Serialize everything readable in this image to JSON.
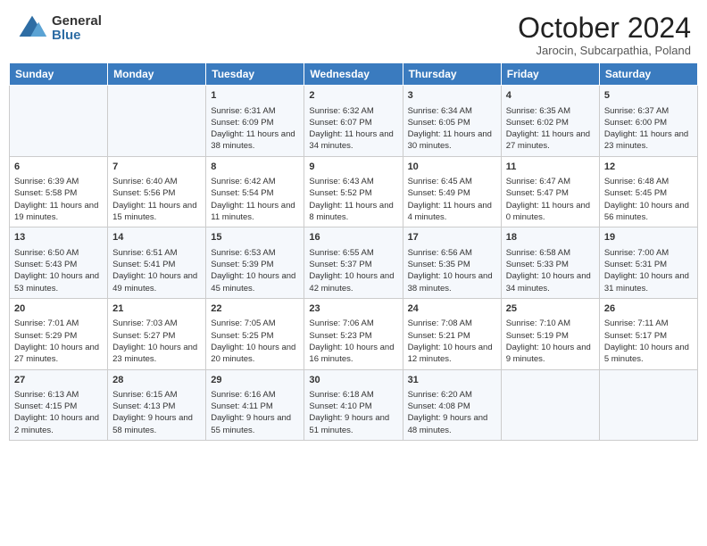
{
  "header": {
    "logo_general": "General",
    "logo_blue": "Blue",
    "month_title": "October 2024",
    "subtitle": "Jarocin, Subcarpathia, Poland"
  },
  "days_of_week": [
    "Sunday",
    "Monday",
    "Tuesday",
    "Wednesday",
    "Thursday",
    "Friday",
    "Saturday"
  ],
  "weeks": [
    [
      {
        "day": "",
        "content": ""
      },
      {
        "day": "",
        "content": ""
      },
      {
        "day": "1",
        "content": "Sunrise: 6:31 AM\nSunset: 6:09 PM\nDaylight: 11 hours and 38 minutes."
      },
      {
        "day": "2",
        "content": "Sunrise: 6:32 AM\nSunset: 6:07 PM\nDaylight: 11 hours and 34 minutes."
      },
      {
        "day": "3",
        "content": "Sunrise: 6:34 AM\nSunset: 6:05 PM\nDaylight: 11 hours and 30 minutes."
      },
      {
        "day": "4",
        "content": "Sunrise: 6:35 AM\nSunset: 6:02 PM\nDaylight: 11 hours and 27 minutes."
      },
      {
        "day": "5",
        "content": "Sunrise: 6:37 AM\nSunset: 6:00 PM\nDaylight: 11 hours and 23 minutes."
      }
    ],
    [
      {
        "day": "6",
        "content": "Sunrise: 6:39 AM\nSunset: 5:58 PM\nDaylight: 11 hours and 19 minutes."
      },
      {
        "day": "7",
        "content": "Sunrise: 6:40 AM\nSunset: 5:56 PM\nDaylight: 11 hours and 15 minutes."
      },
      {
        "day": "8",
        "content": "Sunrise: 6:42 AM\nSunset: 5:54 PM\nDaylight: 11 hours and 11 minutes."
      },
      {
        "day": "9",
        "content": "Sunrise: 6:43 AM\nSunset: 5:52 PM\nDaylight: 11 hours and 8 minutes."
      },
      {
        "day": "10",
        "content": "Sunrise: 6:45 AM\nSunset: 5:49 PM\nDaylight: 11 hours and 4 minutes."
      },
      {
        "day": "11",
        "content": "Sunrise: 6:47 AM\nSunset: 5:47 PM\nDaylight: 11 hours and 0 minutes."
      },
      {
        "day": "12",
        "content": "Sunrise: 6:48 AM\nSunset: 5:45 PM\nDaylight: 10 hours and 56 minutes."
      }
    ],
    [
      {
        "day": "13",
        "content": "Sunrise: 6:50 AM\nSunset: 5:43 PM\nDaylight: 10 hours and 53 minutes."
      },
      {
        "day": "14",
        "content": "Sunrise: 6:51 AM\nSunset: 5:41 PM\nDaylight: 10 hours and 49 minutes."
      },
      {
        "day": "15",
        "content": "Sunrise: 6:53 AM\nSunset: 5:39 PM\nDaylight: 10 hours and 45 minutes."
      },
      {
        "day": "16",
        "content": "Sunrise: 6:55 AM\nSunset: 5:37 PM\nDaylight: 10 hours and 42 minutes."
      },
      {
        "day": "17",
        "content": "Sunrise: 6:56 AM\nSunset: 5:35 PM\nDaylight: 10 hours and 38 minutes."
      },
      {
        "day": "18",
        "content": "Sunrise: 6:58 AM\nSunset: 5:33 PM\nDaylight: 10 hours and 34 minutes."
      },
      {
        "day": "19",
        "content": "Sunrise: 7:00 AM\nSunset: 5:31 PM\nDaylight: 10 hours and 31 minutes."
      }
    ],
    [
      {
        "day": "20",
        "content": "Sunrise: 7:01 AM\nSunset: 5:29 PM\nDaylight: 10 hours and 27 minutes."
      },
      {
        "day": "21",
        "content": "Sunrise: 7:03 AM\nSunset: 5:27 PM\nDaylight: 10 hours and 23 minutes."
      },
      {
        "day": "22",
        "content": "Sunrise: 7:05 AM\nSunset: 5:25 PM\nDaylight: 10 hours and 20 minutes."
      },
      {
        "day": "23",
        "content": "Sunrise: 7:06 AM\nSunset: 5:23 PM\nDaylight: 10 hours and 16 minutes."
      },
      {
        "day": "24",
        "content": "Sunrise: 7:08 AM\nSunset: 5:21 PM\nDaylight: 10 hours and 12 minutes."
      },
      {
        "day": "25",
        "content": "Sunrise: 7:10 AM\nSunset: 5:19 PM\nDaylight: 10 hours and 9 minutes."
      },
      {
        "day": "26",
        "content": "Sunrise: 7:11 AM\nSunset: 5:17 PM\nDaylight: 10 hours and 5 minutes."
      }
    ],
    [
      {
        "day": "27",
        "content": "Sunrise: 6:13 AM\nSunset: 4:15 PM\nDaylight: 10 hours and 2 minutes."
      },
      {
        "day": "28",
        "content": "Sunrise: 6:15 AM\nSunset: 4:13 PM\nDaylight: 9 hours and 58 minutes."
      },
      {
        "day": "29",
        "content": "Sunrise: 6:16 AM\nSunset: 4:11 PM\nDaylight: 9 hours and 55 minutes."
      },
      {
        "day": "30",
        "content": "Sunrise: 6:18 AM\nSunset: 4:10 PM\nDaylight: 9 hours and 51 minutes."
      },
      {
        "day": "31",
        "content": "Sunrise: 6:20 AM\nSunset: 4:08 PM\nDaylight: 9 hours and 48 minutes."
      },
      {
        "day": "",
        "content": ""
      },
      {
        "day": "",
        "content": ""
      }
    ]
  ]
}
